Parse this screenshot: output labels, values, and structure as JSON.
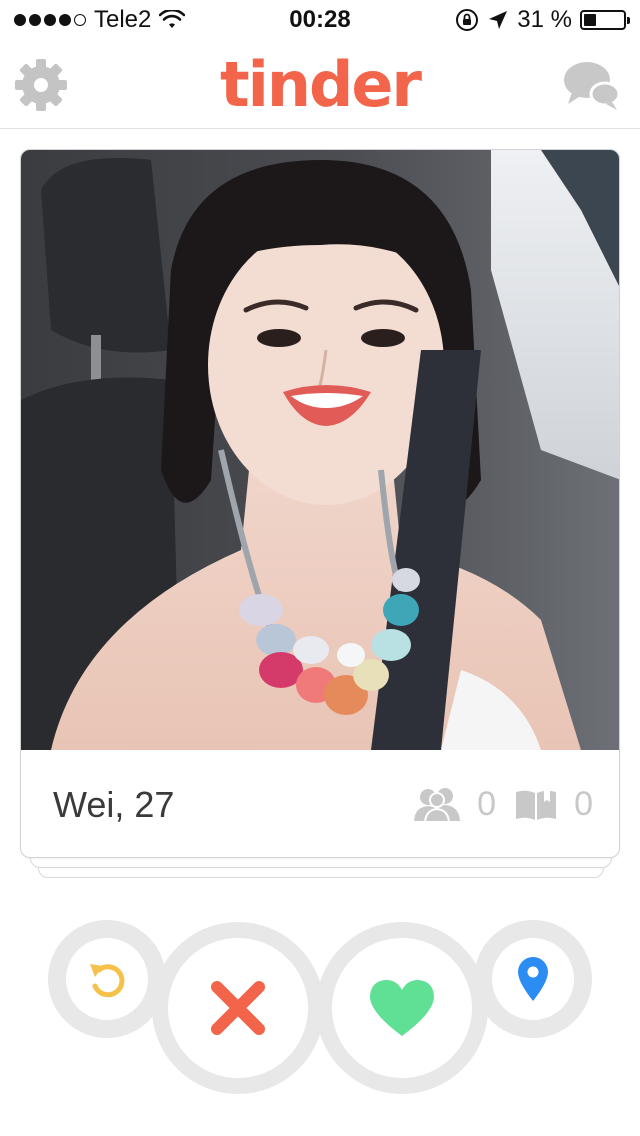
{
  "status_bar": {
    "carrier": "Tele2",
    "time": "00:28",
    "battery_percent": "31 %",
    "battery_level": 0.31,
    "signal_bars_filled": 4,
    "signal_bars_total": 5
  },
  "header": {
    "logo_text": "tinder",
    "settings_icon": "gear-icon",
    "messages_icon": "chat-bubbles-icon"
  },
  "card": {
    "name_age": "Wei, 27",
    "common_friends_count": "0",
    "common_interests_count": "0",
    "friends_icon": "people-icon",
    "interests_icon": "book-icon"
  },
  "actions": {
    "undo_icon": "undo-icon",
    "nope_icon": "x-icon",
    "like_icon": "heart-icon",
    "boost_icon": "location-pin-icon"
  },
  "colors": {
    "brand": "#f2654b",
    "like": "#5fe095",
    "nope": "#f2654b",
    "undo": "#f5c14b",
    "boost": "#2b8cf2",
    "icon_grey": "#c8c8c8"
  }
}
